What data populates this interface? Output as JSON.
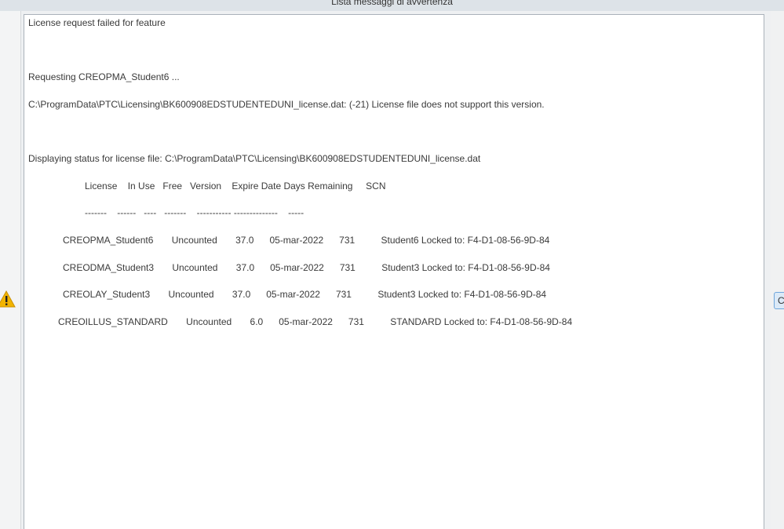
{
  "window": {
    "title": "Lista messaggi di avvertenza"
  },
  "icons": {
    "warning": "warning-triangle-icon"
  },
  "messages": {
    "line1": "License request failed for feature",
    "line2": "Requesting CREOPMA_Student6 ...",
    "line3": "C:\\ProgramData\\PTC\\Licensing\\BK600908EDSTUDENTEDUNI_license.dat: (-21) License file does not support this version.",
    "line4": "Displaying status for license file: C:\\ProgramData\\PTC\\Licensing\\BK600908EDSTUDENTEDUNI_license.dat",
    "header": "License    In Use   Free   Version    Expire Date Days Remaining     SCN",
    "separator": "-------    ------   ----   -------    ----------- --------------    -----",
    "row1": "CREOPMA_Student6       Uncounted       37.0      05-mar-2022      731          Student6 Locked to: F4-D1-08-56-9D-84",
    "row2": "CREODMA_Student3       Uncounted       37.0      05-mar-2022      731          Student3 Locked to: F4-D1-08-56-9D-84",
    "row3": "CREOLAY_Student3       Uncounted       37.0      05-mar-2022      731          Student3 Locked to: F4-D1-08-56-9D-84",
    "row4": "CREOILLUS_STANDARD       Uncounted       6.0      05-mar-2022      731          STANDARD Locked to: F4-D1-08-56-9D-84"
  },
  "side_button": {
    "label": "C"
  },
  "colors": {
    "warning_fill": "#f2b400",
    "button_border": "#6fa6dc"
  }
}
